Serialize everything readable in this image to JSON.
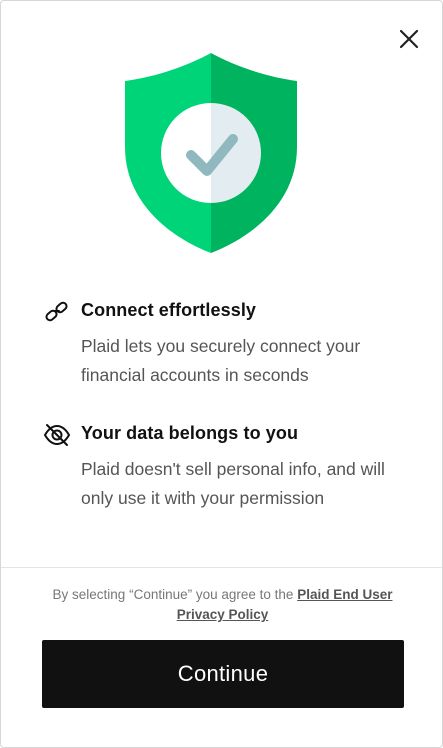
{
  "header": {
    "close_icon": "close-icon"
  },
  "hero": {
    "icon": "shield-check-icon",
    "colors": {
      "shield_left": "#00d478",
      "shield_right": "#00b35e",
      "check": "#8fb9be",
      "circle": "#eef2f4"
    }
  },
  "features": [
    {
      "icon": "link-icon",
      "title": "Connect effortlessly",
      "description": "Plaid lets you securely connect your financial accounts in seconds"
    },
    {
      "icon": "eye-slash-icon",
      "title": "Your data belongs to you",
      "description": "Plaid doesn't sell personal info, and will only use it with your permission"
    }
  ],
  "footer": {
    "consent_prefix": "By selecting “Continue” you agree to the ",
    "consent_link": "Plaid End User Privacy Policy",
    "continue_label": "Continue",
    "button_color": "#111111"
  }
}
